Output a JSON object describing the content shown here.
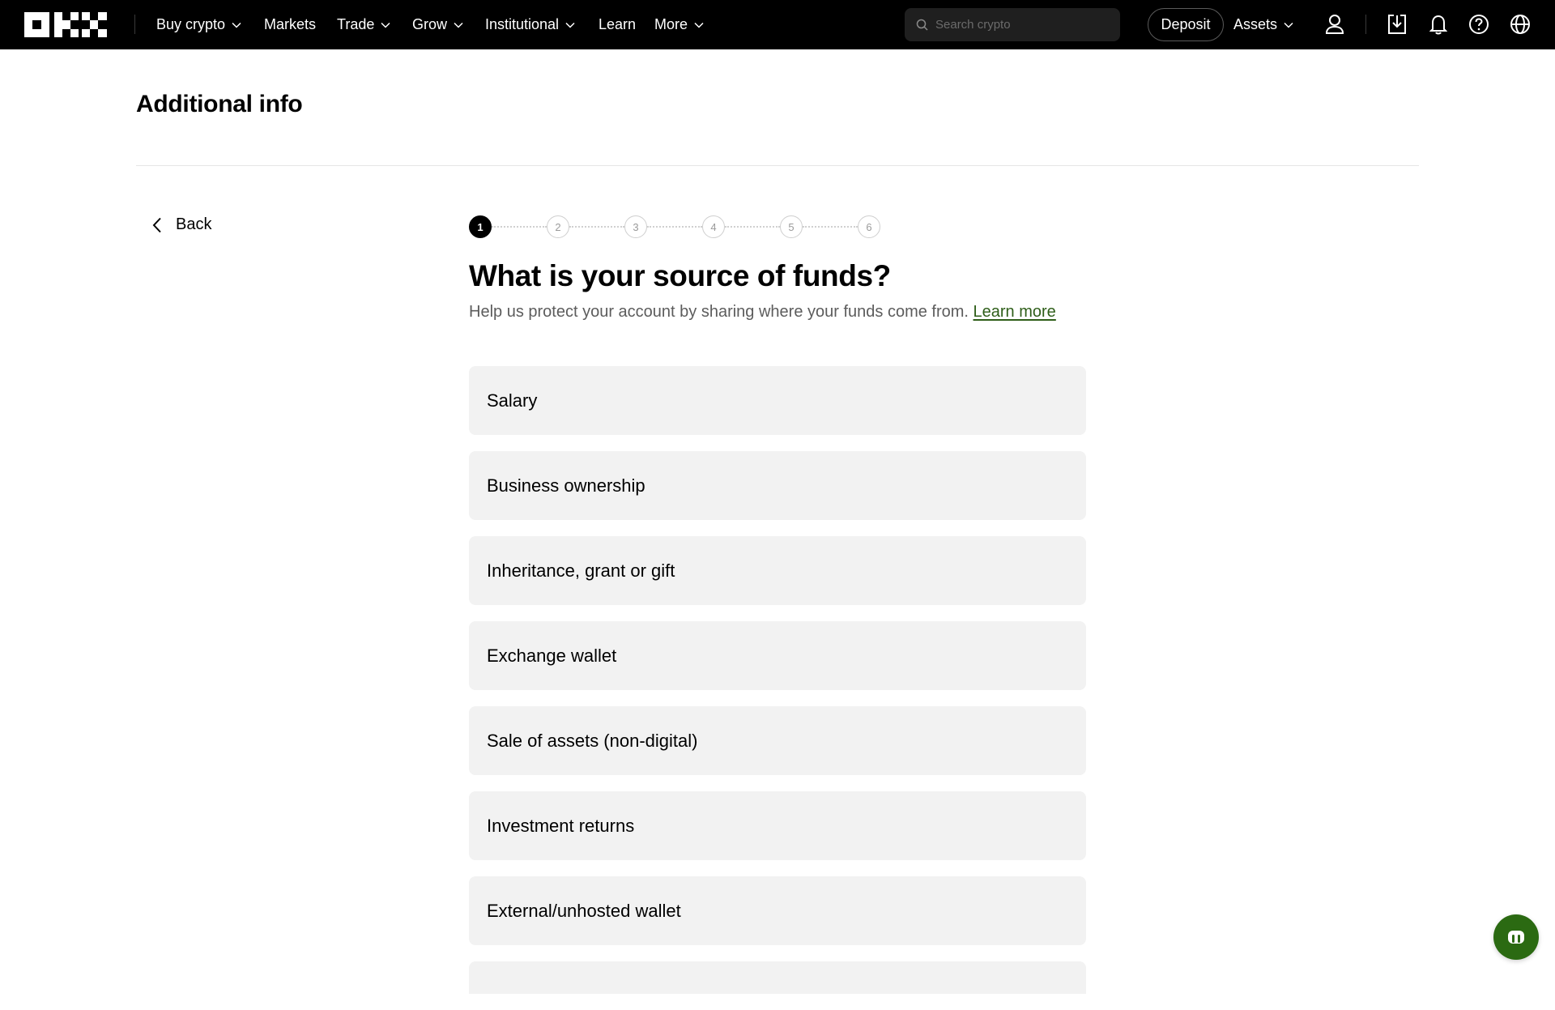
{
  "nav": {
    "items": [
      {
        "label": "Buy crypto",
        "dropdown": true
      },
      {
        "label": "Markets",
        "dropdown": false
      },
      {
        "label": "Trade",
        "dropdown": true
      },
      {
        "label": "Grow",
        "dropdown": true
      },
      {
        "label": "Institutional",
        "dropdown": true
      },
      {
        "label": "Learn",
        "dropdown": false
      },
      {
        "label": "More",
        "dropdown": true
      }
    ],
    "search_placeholder": "Search crypto",
    "deposit_label": "Deposit",
    "assets_label": "Assets",
    "icons": [
      "user-icon",
      "download-icon",
      "bell-icon",
      "help-icon",
      "globe-icon"
    ]
  },
  "page": {
    "title": "Additional info",
    "back_label": "Back"
  },
  "stepper": {
    "steps": [
      "1",
      "2",
      "3",
      "4",
      "5",
      "6"
    ],
    "current": 1
  },
  "question": {
    "title": "What is your source of funds?",
    "subtext": "Help us protect your account by sharing where your funds come from.",
    "learn_more": "Learn more"
  },
  "options": [
    "Salary",
    "Business ownership",
    "Inheritance, grant or gift",
    "Exchange wallet",
    "Sale of assets (non-digital)",
    "Investment returns",
    "External/unhosted wallet"
  ],
  "colors": {
    "nav_bg": "#000000",
    "option_bg": "#f2f2f2",
    "link": "#2e5e19",
    "support_button": "#2b6a12"
  }
}
